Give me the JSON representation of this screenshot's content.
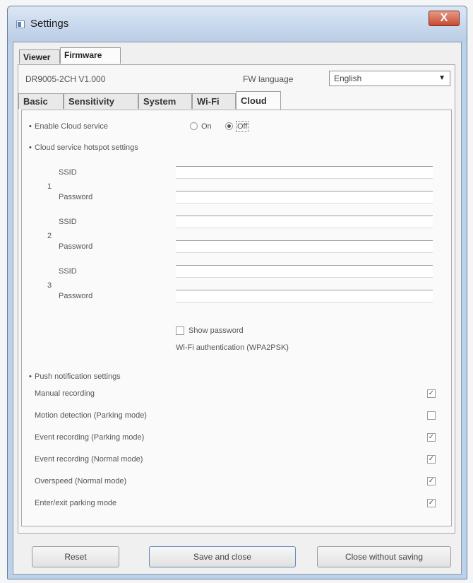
{
  "window": {
    "title": "Settings",
    "close_glyph": "X"
  },
  "top_tabs": [
    {
      "label": "Viewer",
      "active": false
    },
    {
      "label": "Firmware",
      "active": true
    }
  ],
  "device": {
    "model": "DR9005-2CH  V1.000",
    "fw_language_label": "FW language",
    "fw_language_value": "English",
    "dropdown_arrow": "▼"
  },
  "inner_tabs": [
    {
      "label": "Basic",
      "active": false
    },
    {
      "label": "Sensitivity",
      "active": false
    },
    {
      "label": "System",
      "active": false
    },
    {
      "label": "Wi-Fi",
      "active": false
    },
    {
      "label": "Cloud",
      "active": true
    }
  ],
  "cloud": {
    "bullet": "•",
    "enable_label": "Enable Cloud service",
    "on_label": "On",
    "off_label": "Off",
    "enabled": false,
    "hotspot_label": "Cloud service hotspot settings",
    "hotspots": [
      {
        "index": "1",
        "ssid_label": "SSID",
        "password_label": "Password",
        "ssid_value": "",
        "password_value": ""
      },
      {
        "index": "2",
        "ssid_label": "SSID",
        "password_label": "Password",
        "ssid_value": "",
        "password_value": ""
      },
      {
        "index": "3",
        "ssid_label": "SSID",
        "password_label": "Password",
        "ssid_value": "",
        "password_value": ""
      }
    ],
    "show_password_label": "Show password",
    "show_password_checked": false,
    "auth_text": "Wi-Fi authentication (WPA2PSK)",
    "push_label": "Push notification settings",
    "push_items": [
      {
        "label": "Manual recording",
        "checked": true
      },
      {
        "label": "Motion detection (Parking mode)",
        "checked": false
      },
      {
        "label": "Event recording (Parking mode)",
        "checked": true
      },
      {
        "label": "Event recording (Normal mode)",
        "checked": true
      },
      {
        "label": "Overspeed (Normal mode)",
        "checked": true
      },
      {
        "label": "Enter/exit parking mode",
        "checked": true
      }
    ]
  },
  "buttons": {
    "reset": "Reset",
    "save_close": "Save and close",
    "close_without_saving": "Close without saving"
  },
  "colors": {
    "titlebar": "#bcd1ea",
    "close_button": "#c64a33",
    "panel": "#fafafa"
  }
}
